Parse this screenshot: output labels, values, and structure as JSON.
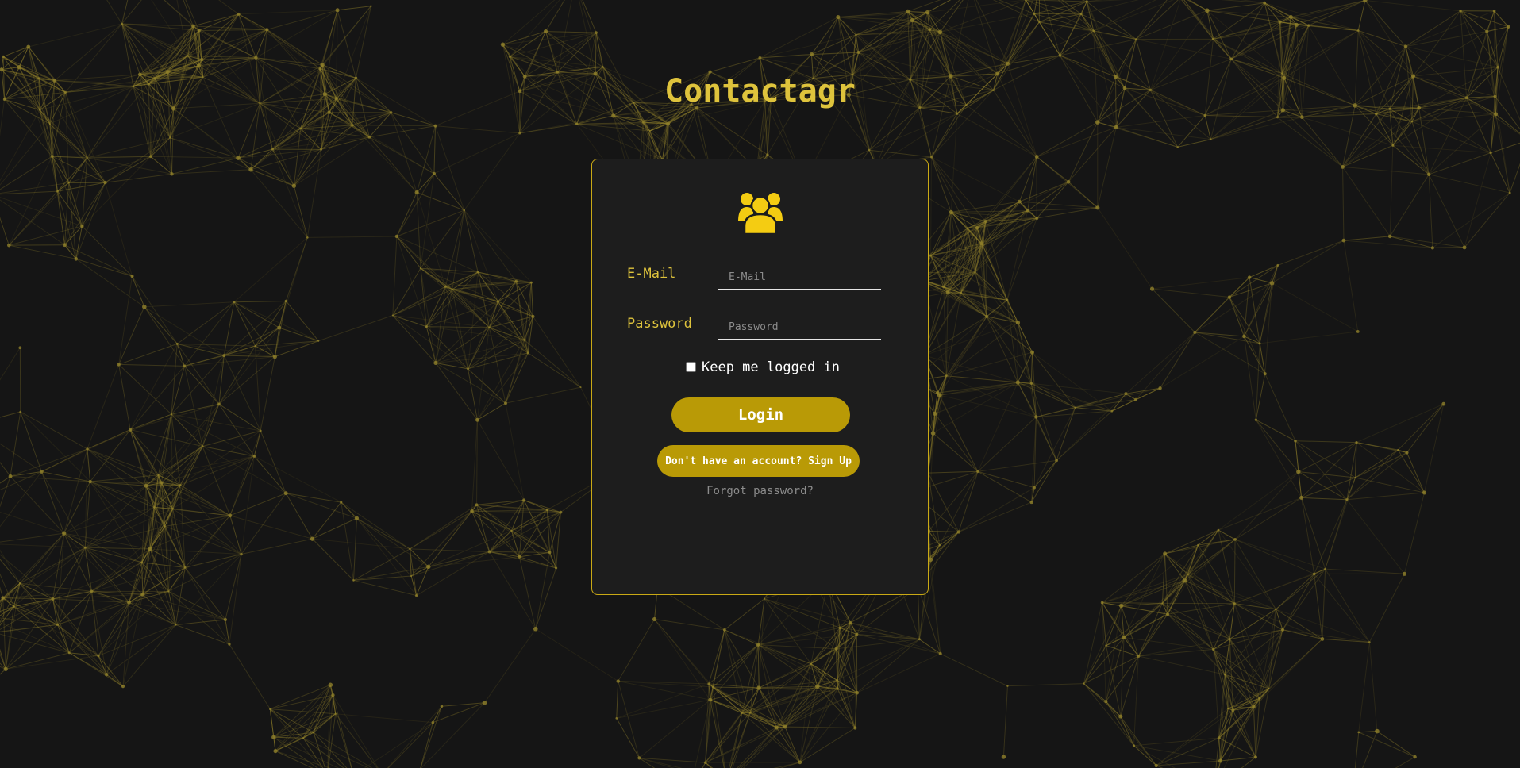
{
  "app": {
    "title": "Contactagr"
  },
  "login_form": {
    "icon": "users-icon",
    "email_label": "E-Mail",
    "email_placeholder": "E-Mail",
    "email_value": "",
    "password_label": "Password",
    "password_placeholder": "Password",
    "password_value": "",
    "remember_label": "Keep me logged in",
    "remember_checked": false,
    "login_button": "Login",
    "signup_button": "Don't have an account? Sign Up",
    "forgot_link": "Forgot password?"
  },
  "colors": {
    "background": "#151515",
    "card": "#1d1d1d",
    "accent": "#dec33c",
    "button": "#b99a06",
    "network_lines": "#8f7f2a"
  }
}
